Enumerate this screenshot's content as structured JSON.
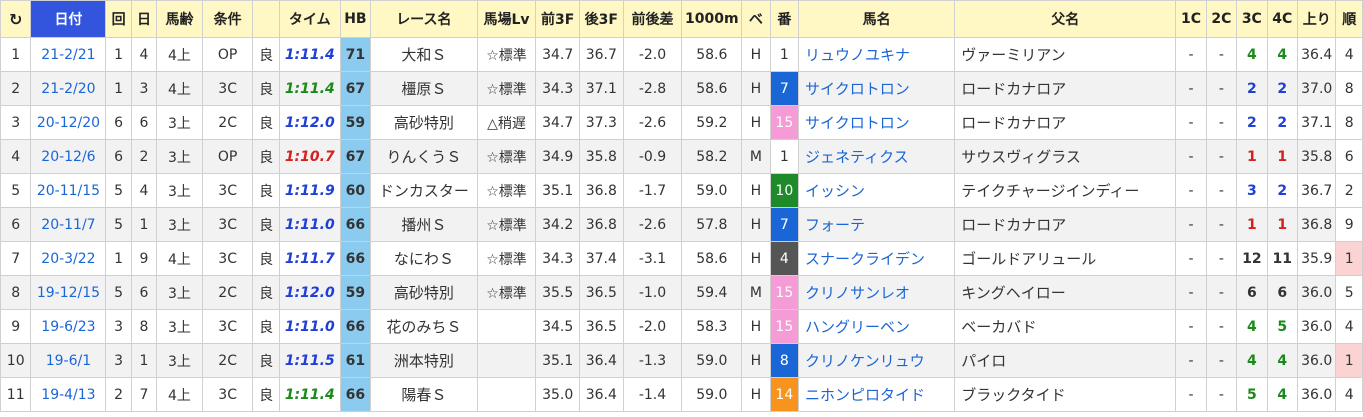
{
  "headers": {
    "date": "日付",
    "kai": "回",
    "nichi": "日",
    "age": "馬齢",
    "cond": "条件",
    "time": "タイム",
    "hb": "HB",
    "race": "レース名",
    "baba": "馬場Lv",
    "f3": "前3F",
    "l3": "後3F",
    "diff": "前後差",
    "m1000": "1000m",
    "be": "ベ",
    "ban": "番",
    "horse": "馬名",
    "sire": "父名",
    "c1": "1C",
    "c2": "2C",
    "c3": "3C",
    "c4": "4C",
    "agari": "上り",
    "jun": "順"
  },
  "time_colors": {
    "green": "#1a8a1a",
    "blue": "#1f3fd6",
    "red": "#d62020"
  },
  "gate_colors": {
    "white": "#ffffff",
    "blue": "#1a66d6",
    "pink": "#f59bd6",
    "green": "#1f8a2a",
    "gray": "#555555",
    "orange": "#f7941d",
    "black": "#222222"
  },
  "rows": [
    {
      "idx": "1",
      "date": "21-2/21",
      "kai": "1",
      "nichi": "4",
      "age": "4上",
      "cond": "OP",
      "going": "良",
      "time": "1:11.4",
      "time_color": "blue",
      "hb": "71",
      "race": "大和Ｓ",
      "baba": "☆標準",
      "f3": "34.7",
      "l3": "36.7",
      "diff": "-2.0",
      "m1000": "58.6",
      "be": "H",
      "ban": "1",
      "gate": "white",
      "horse": "リュウノユキナ",
      "sire": "ヴァーミリアン",
      "c1": "-",
      "c2": "-",
      "c3": "4",
      "c3c": "green",
      "c4": "4",
      "c4c": "green",
      "agari": "36.4",
      "jun": "4",
      "juncol": "#ffffff"
    },
    {
      "idx": "2",
      "date": "21-2/20",
      "kai": "1",
      "nichi": "3",
      "age": "4上",
      "cond": "3C",
      "going": "良",
      "time": "1:11.4",
      "time_color": "green",
      "hb": "67",
      "race": "橿原Ｓ",
      "baba": "☆標準",
      "f3": "34.3",
      "l3": "37.1",
      "diff": "-2.8",
      "m1000": "58.6",
      "be": "H",
      "ban": "7",
      "gate": "blue",
      "horse": "サイクロトロン",
      "sire": "ロードカナロア",
      "c1": "-",
      "c2": "-",
      "c3": "2",
      "c3c": "blue",
      "c4": "2",
      "c4c": "blue",
      "agari": "37.0",
      "jun": "8",
      "juncol": "#ffffff"
    },
    {
      "idx": "3",
      "date": "20-12/20",
      "kai": "6",
      "nichi": "6",
      "age": "3上",
      "cond": "2C",
      "going": "良",
      "time": "1:12.0",
      "time_color": "blue",
      "hb": "59",
      "race": "高砂特別",
      "baba": "△稍遅",
      "f3": "34.7",
      "l3": "37.3",
      "diff": "-2.6",
      "m1000": "59.2",
      "be": "H",
      "ban": "15",
      "gate": "pink",
      "horse": "サイクロトロン",
      "sire": "ロードカナロア",
      "c1": "-",
      "c2": "-",
      "c3": "2",
      "c3c": "blue",
      "c4": "2",
      "c4c": "blue",
      "agari": "37.1",
      "jun": "8",
      "juncol": "#ffffff"
    },
    {
      "idx": "4",
      "date": "20-12/6",
      "kai": "6",
      "nichi": "2",
      "age": "3上",
      "cond": "OP",
      "going": "良",
      "time": "1:10.7",
      "time_color": "red",
      "hb": "67",
      "race": "りんくうＳ",
      "baba": "☆標準",
      "f3": "34.9",
      "l3": "35.8",
      "diff": "-0.9",
      "m1000": "58.2",
      "be": "M",
      "ban": "1",
      "gate": "white",
      "horse": "ジェネティクス",
      "sire": "サウスヴィグラス",
      "c1": "-",
      "c2": "-",
      "c3": "1",
      "c3c": "red",
      "c4": "1",
      "c4c": "red",
      "agari": "35.8",
      "jun": "6",
      "juncol": "#ffffff"
    },
    {
      "idx": "5",
      "date": "20-11/15",
      "kai": "5",
      "nichi": "4",
      "age": "3上",
      "cond": "3C",
      "going": "良",
      "time": "1:11.9",
      "time_color": "blue",
      "hb": "60",
      "race": "ドンカスター",
      "baba": "☆標準",
      "f3": "35.1",
      "l3": "36.8",
      "diff": "-1.7",
      "m1000": "59.0",
      "be": "H",
      "ban": "10",
      "gate": "green",
      "horse": "イッシン",
      "sire": "テイクチャージインディー",
      "c1": "-",
      "c2": "-",
      "c3": "3",
      "c3c": "blue",
      "c4": "2",
      "c4c": "blue",
      "agari": "36.7",
      "jun": "2",
      "juncol": "#ffffff"
    },
    {
      "idx": "6",
      "date": "20-11/7",
      "kai": "5",
      "nichi": "1",
      "age": "3上",
      "cond": "3C",
      "going": "良",
      "time": "1:11.0",
      "time_color": "blue",
      "hb": "66",
      "race": "播州Ｓ",
      "baba": "☆標準",
      "f3": "34.2",
      "l3": "36.8",
      "diff": "-2.6",
      "m1000": "57.8",
      "be": "H",
      "ban": "7",
      "gate": "blue",
      "horse": "フォーテ",
      "sire": "ロードカナロア",
      "c1": "-",
      "c2": "-",
      "c3": "1",
      "c3c": "red",
      "c4": "1",
      "c4c": "red",
      "agari": "36.8",
      "jun": "9",
      "juncol": "#ffffff"
    },
    {
      "idx": "7",
      "date": "20-3/22",
      "kai": "1",
      "nichi": "9",
      "age": "4上",
      "cond": "3C",
      "going": "良",
      "time": "1:11.7",
      "time_color": "blue",
      "hb": "66",
      "race": "なにわＳ",
      "baba": "☆標準",
      "f3": "34.3",
      "l3": "37.4",
      "diff": "-3.1",
      "m1000": "58.6",
      "be": "H",
      "ban": "4",
      "gate": "gray",
      "horse": "スナークライデン",
      "sire": "ゴールドアリュール",
      "c1": "-",
      "c2": "-",
      "c3": "12",
      "c3c": "plain",
      "c4": "11",
      "c4c": "plain",
      "agari": "35.9",
      "jun": "1",
      "juncol": "#fbd3d3"
    },
    {
      "idx": "8",
      "date": "19-12/15",
      "kai": "5",
      "nichi": "6",
      "age": "3上",
      "cond": "2C",
      "going": "良",
      "time": "1:12.0",
      "time_color": "blue",
      "hb": "59",
      "race": "高砂特別",
      "baba": "☆標準",
      "f3": "35.5",
      "l3": "36.5",
      "diff": "-1.0",
      "m1000": "59.4",
      "be": "M",
      "ban": "15",
      "gate": "pink",
      "horse": "クリノサンレオ",
      "sire": "キングヘイロー",
      "c1": "-",
      "c2": "-",
      "c3": "6",
      "c3c": "plain",
      "c4": "6",
      "c4c": "plain",
      "agari": "36.0",
      "jun": "5",
      "juncol": "#ffffff"
    },
    {
      "idx": "9",
      "date": "19-6/23",
      "kai": "3",
      "nichi": "8",
      "age": "3上",
      "cond": "3C",
      "going": "良",
      "time": "1:11.0",
      "time_color": "blue",
      "hb": "66",
      "race": "花のみちＳ",
      "baba": "",
      "f3": "34.5",
      "l3": "36.5",
      "diff": "-2.0",
      "m1000": "58.3",
      "be": "H",
      "ban": "15",
      "gate": "pink",
      "horse": "ハングリーベン",
      "sire": "ベーカバド",
      "c1": "-",
      "c2": "-",
      "c3": "4",
      "c3c": "green",
      "c4": "5",
      "c4c": "green",
      "agari": "36.0",
      "jun": "4",
      "juncol": "#ffffff"
    },
    {
      "idx": "10",
      "date": "19-6/1",
      "kai": "3",
      "nichi": "1",
      "age": "3上",
      "cond": "2C",
      "going": "良",
      "time": "1:11.5",
      "time_color": "blue",
      "hb": "61",
      "race": "洲本特別",
      "baba": "",
      "f3": "35.1",
      "l3": "36.4",
      "diff": "-1.3",
      "m1000": "59.0",
      "be": "H",
      "ban": "8",
      "gate": "blue",
      "horse": "クリノケンリュウ",
      "sire": "パイロ",
      "c1": "-",
      "c2": "-",
      "c3": "4",
      "c3c": "green",
      "c4": "4",
      "c4c": "green",
      "agari": "36.0",
      "jun": "1",
      "juncol": "#fbd3d3"
    },
    {
      "idx": "11",
      "date": "19-4/13",
      "kai": "2",
      "nichi": "7",
      "age": "4上",
      "cond": "3C",
      "going": "良",
      "time": "1:11.4",
      "time_color": "green",
      "hb": "66",
      "race": "陽春Ｓ",
      "baba": "",
      "f3": "35.0",
      "l3": "36.4",
      "diff": "-1.4",
      "m1000": "59.0",
      "be": "H",
      "ban": "14",
      "gate": "orange",
      "horse": "ニホンピロタイド",
      "sire": "ブラックタイド",
      "c1": "-",
      "c2": "-",
      "c3": "5",
      "c3c": "green",
      "c4": "4",
      "c4c": "green",
      "agari": "36.0",
      "jun": "4",
      "juncol": "#ffffff"
    }
  ]
}
